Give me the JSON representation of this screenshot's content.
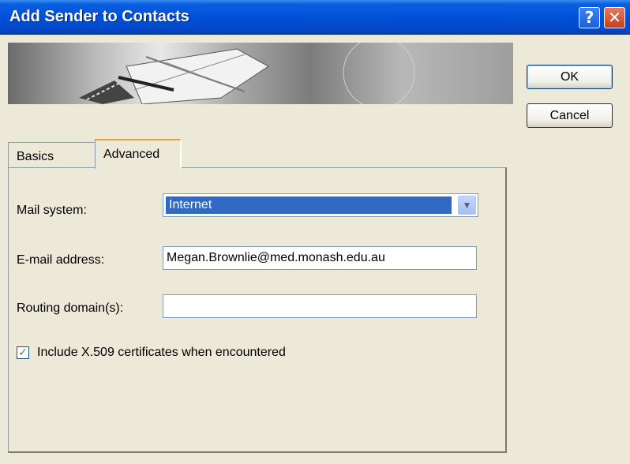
{
  "window": {
    "title": "Add Sender to Contacts",
    "help_label": "?",
    "close_label": "✕"
  },
  "buttons": {
    "ok": "OK",
    "cancel": "Cancel"
  },
  "tabs": [
    {
      "label": "Basics",
      "selected": false
    },
    {
      "label": "Advanced",
      "selected": true
    }
  ],
  "form": {
    "mail_system_label": "Mail system:",
    "mail_system_value": "Internet",
    "email_label": "E-mail address:",
    "email_value": "Megan.Brownlie@med.monash.edu.au",
    "routing_label": "Routing domain(s):",
    "routing_value": "",
    "include_cert_label": "Include X.509 certificates when encountered",
    "include_cert_checked": true,
    "checkmark": "✓"
  },
  "icons": {
    "dropdown": "chevron-down-icon",
    "banner": "notebook-pen-banner"
  },
  "colors": {
    "titlebar": "#0050d8",
    "selection": "#316ac5",
    "dialog_bg": "#ece9d8"
  }
}
